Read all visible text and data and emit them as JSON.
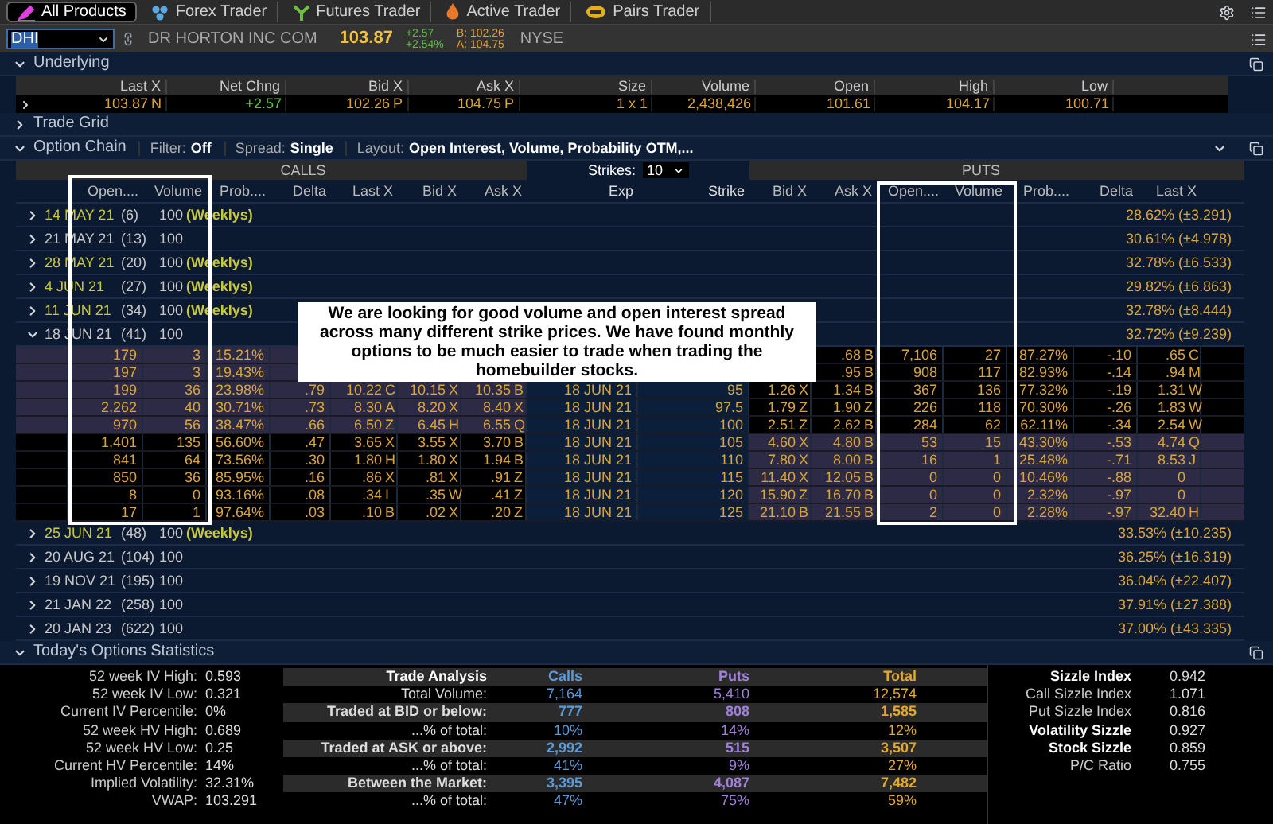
{
  "tabs": [
    {
      "label": "All Products",
      "selected": true,
      "kind": "all"
    },
    {
      "label": "Forex Trader",
      "selected": false,
      "kind": "forex"
    },
    {
      "label": "Futures Trader",
      "selected": false,
      "kind": "futures"
    },
    {
      "label": "Active Trader",
      "selected": false,
      "kind": "active"
    },
    {
      "label": "Pairs Trader",
      "selected": false,
      "kind": "pairs"
    }
  ],
  "symbol": {
    "value": "DHI",
    "company": "DR HORTON INC COM",
    "last": "103.87",
    "change": "+2.57",
    "change_pct": "+2.54%",
    "bid": "B: 102.26",
    "ask": "A: 104.75",
    "exchange": "NYSE"
  },
  "underlying": {
    "title": "Underlying",
    "expanded": true,
    "columns": [
      "Last X",
      "Net Chng",
      "Bid X",
      "Ask X",
      "Size",
      "Volume",
      "Open",
      "High",
      "Low"
    ],
    "values": [
      {
        "text": "103.87",
        "exch": "N",
        "kind": "price"
      },
      {
        "text": "+2.57",
        "kind": "change"
      },
      {
        "text": "102.26",
        "exch": "P",
        "kind": "price"
      },
      {
        "text": "104.75",
        "exch": "P",
        "kind": "price"
      },
      {
        "text": "1 x 1",
        "kind": "price"
      },
      {
        "text": "2,438,426",
        "kind": "price"
      },
      {
        "text": "101.61",
        "kind": "price"
      },
      {
        "text": "104.17",
        "kind": "price"
      },
      {
        "text": "100.71",
        "kind": "price"
      }
    ]
  },
  "trade_grid": {
    "title": "Trade Grid",
    "expanded": false
  },
  "option_chain": {
    "title": "Option Chain",
    "expanded": true,
    "filter_label": "Filter:",
    "filter": "Off",
    "spread_label": "Spread:",
    "spread": "Single",
    "layout_label": "Layout:",
    "layout": "Open Interest, Volume, Probability OTM,...",
    "calls_label": "CALLS",
    "puts_label": "PUTS",
    "strikes_label": "Strikes:",
    "strikes": "10",
    "columns": [
      "Open....",
      "Volume",
      "Prob....",
      "Delta",
      "Last X",
      "Bid X",
      "Ask X",
      "Exp",
      "Strike",
      "Bid X",
      "Ask X",
      "Open....",
      "Volume",
      "Prob....",
      "Delta",
      "Last X"
    ],
    "expirations": [
      {
        "date": "14 MAY 21",
        "days": "(6)",
        "multiplier": "100",
        "weeklys": "(Weeklys)",
        "weekly": true,
        "expanded": false,
        "iv": "28.62% (±3.291)"
      },
      {
        "date": "21 MAY 21",
        "days": "(13)",
        "multiplier": "100",
        "weekly": false,
        "expanded": false,
        "iv": "30.61% (±4.978)"
      },
      {
        "date": "28 MAY 21",
        "days": "(20)",
        "multiplier": "100",
        "weeklys": "(Weeklys)",
        "weekly": true,
        "expanded": false,
        "iv": "32.78% (±6.533)"
      },
      {
        "date": "4 JUN 21",
        "days": "(27)",
        "multiplier": "100",
        "weeklys": "(Weeklys)",
        "weekly": true,
        "expanded": false,
        "iv": "29.82% (±6.863)"
      },
      {
        "date": "11 JUN 21",
        "days": "(34)",
        "multiplier": "100",
        "weeklys": "(Weeklys)",
        "weekly": true,
        "expanded": false,
        "iv": "32.78% (±8.444)"
      },
      {
        "date": "18 JUN 21",
        "days": "(41)",
        "multiplier": "100",
        "weekly": false,
        "expanded": true,
        "iv": "32.72% (±9.239)",
        "rows": [
          {
            "call_itm": true,
            "put_itm": false,
            "call": {
              "open": "179",
              "volume": "3",
              "prob": "15.21%"
            },
            "put": {
              "ask": ".68",
              "ask_x": "B",
              "open": "7,106",
              "volume": "27",
              "prob": "87.27%",
              "delta": "-.10",
              "last": ".65",
              "last_x": "C"
            }
          },
          {
            "call_itm": true,
            "put_itm": false,
            "call": {
              "open": "197",
              "volume": "3",
              "prob": "19.43%"
            },
            "put": {
              "ask": ".95",
              "ask_x": "B",
              "open": "908",
              "volume": "117",
              "prob": "82.93%",
              "delta": "-.14",
              "last": ".94",
              "last_x": "M"
            }
          },
          {
            "call_itm": true,
            "put_itm": false,
            "exp": "18 JUN 21",
            "strike": "95",
            "call": {
              "open": "199",
              "volume": "36",
              "prob": "23.98%",
              "delta": ".79",
              "last": "10.22",
              "last_x": "C",
              "bid": "10.15",
              "bid_x": "X",
              "ask": "10.35",
              "ask_x": "B"
            },
            "put": {
              "bid": "1.26",
              "bid_x": "X",
              "ask": "1.34",
              "ask_x": "B",
              "open": "367",
              "volume": "136",
              "prob": "77.32%",
              "delta": "-.19",
              "last": "1.31",
              "last_x": "W"
            }
          },
          {
            "call_itm": true,
            "put_itm": false,
            "exp": "18 JUN 21",
            "strike": "97.5",
            "call": {
              "open": "2,262",
              "volume": "40",
              "prob": "30.71%",
              "delta": ".73",
              "last": "8.30",
              "last_x": "A",
              "bid": "8.20",
              "bid_x": "X",
              "ask": "8.40",
              "ask_x": "X"
            },
            "put": {
              "bid": "1.79",
              "bid_x": "Z",
              "ask": "1.90",
              "ask_x": "Z",
              "open": "226",
              "volume": "118",
              "prob": "70.30%",
              "delta": "-.26",
              "last": "1.83",
              "last_x": "W"
            }
          },
          {
            "call_itm": true,
            "put_itm": false,
            "exp": "18 JUN 21",
            "strike": "100",
            "call": {
              "open": "970",
              "volume": "56",
              "prob": "38.47%",
              "delta": ".66",
              "last": "6.50",
              "last_x": "Z",
              "bid": "6.45",
              "bid_x": "H",
              "ask": "6.55",
              "ask_x": "Q"
            },
            "put": {
              "bid": "2.51",
              "bid_x": "Z",
              "ask": "2.62",
              "ask_x": "B",
              "open": "284",
              "volume": "62",
              "prob": "62.11%",
              "delta": "-.34",
              "last": "2.54",
              "last_x": "W"
            }
          },
          {
            "call_itm": false,
            "put_itm": true,
            "exp": "18 JUN 21",
            "strike": "105",
            "call": {
              "open": "1,401",
              "volume": "135",
              "prob": "56.60%",
              "delta": ".47",
              "last": "3.65",
              "last_x": "X",
              "bid": "3.55",
              "bid_x": "X",
              "ask": "3.70",
              "ask_x": "B"
            },
            "put": {
              "bid": "4.60",
              "bid_x": "X",
              "ask": "4.80",
              "ask_x": "B",
              "open": "53",
              "volume": "15",
              "prob": "43.30%",
              "delta": "-.53",
              "last": "4.74",
              "last_x": "Q"
            }
          },
          {
            "call_itm": false,
            "put_itm": true,
            "exp": "18 JUN 21",
            "strike": "110",
            "call": {
              "open": "841",
              "volume": "64",
              "prob": "73.56%",
              "delta": ".30",
              "last": "1.80",
              "last_x": "H",
              "bid": "1.80",
              "bid_x": "X",
              "ask": "1.94",
              "ask_x": "B"
            },
            "put": {
              "bid": "7.80",
              "bid_x": "X",
              "ask": "8.00",
              "ask_x": "B",
              "open": "16",
              "volume": "1",
              "prob": "25.48%",
              "delta": "-.71",
              "last": "8.53",
              "last_x": "J"
            }
          },
          {
            "call_itm": false,
            "put_itm": true,
            "exp": "18 JUN 21",
            "strike": "115",
            "call": {
              "open": "850",
              "volume": "36",
              "prob": "85.95%",
              "delta": ".16",
              "last": ".86",
              "last_x": "X",
              "bid": ".81",
              "bid_x": "X",
              "ask": ".91",
              "ask_x": "Z"
            },
            "put": {
              "bid": "11.40",
              "bid_x": "X",
              "ask": "12.05",
              "ask_x": "B",
              "open": "0",
              "volume": "0",
              "prob": "10.46%",
              "delta": "-.88",
              "last": "0"
            }
          },
          {
            "call_itm": false,
            "put_itm": true,
            "exp": "18 JUN 21",
            "strike": "120",
            "call": {
              "open": "8",
              "volume": "0",
              "prob": "93.16%",
              "delta": ".08",
              "last": ".34",
              "last_x": "I",
              "bid": ".35",
              "bid_x": "W",
              "ask": ".41",
              "ask_x": "Z"
            },
            "put": {
              "bid": "15.90",
              "bid_x": "Z",
              "ask": "16.70",
              "ask_x": "B",
              "open": "0",
              "volume": "0",
              "prob": "2.32%",
              "delta": "-.97",
              "last": "0"
            }
          },
          {
            "call_itm": false,
            "put_itm": true,
            "exp": "18 JUN 21",
            "strike": "125",
            "call": {
              "open": "17",
              "volume": "1",
              "prob": "97.64%",
              "delta": ".03",
              "last": ".10",
              "last_x": "B",
              "bid": ".02",
              "bid_x": "X",
              "ask": ".20",
              "ask_x": "Z"
            },
            "put": {
              "bid": "21.10",
              "bid_x": "B",
              "ask": "21.55",
              "ask_x": "B",
              "open": "2",
              "volume": "0",
              "prob": "2.28%",
              "delta": "-.97",
              "last": "32.40",
              "last_x": "H"
            }
          }
        ]
      },
      {
        "date": "25 JUN 21",
        "days": "(48)",
        "multiplier": "100",
        "weeklys": "(Weeklys)",
        "weekly": true,
        "expanded": false,
        "iv": "33.53% (±10.235)"
      },
      {
        "date": "20 AUG 21",
        "days": "(104)",
        "multiplier": "100",
        "weekly": false,
        "expanded": false,
        "iv": "36.25% (±16.319)"
      },
      {
        "date": "19 NOV 21",
        "days": "(195)",
        "multiplier": "100",
        "weekly": false,
        "expanded": false,
        "iv": "36.04% (±22.407)"
      },
      {
        "date": "21 JAN 22",
        "days": "(258)",
        "multiplier": "100",
        "weekly": false,
        "expanded": false,
        "iv": "37.91% (±27.388)"
      },
      {
        "date": "20 JAN 23",
        "days": "(622)",
        "multiplier": "100",
        "weekly": false,
        "expanded": false,
        "iv": "37.00% (±43.335)"
      }
    ],
    "callout": "We are looking for good volume and open interest spread across many different strike prices. We have found monthly options to be much easier to trade when trading the homebuilder stocks."
  },
  "statistics": {
    "title": "Today's Options Statistics",
    "expanded": true,
    "summary": [
      {
        "label": "52 week IV High:",
        "value": "0.593"
      },
      {
        "label": "52 week IV Low:",
        "value": "0.321"
      },
      {
        "label": "Current IV Percentile:",
        "value": "0%"
      },
      {
        "label": "52 week HV High:",
        "value": "0.689"
      },
      {
        "label": "52 week HV Low:",
        "value": "0.25"
      },
      {
        "label": "Current HV Percentile:",
        "value": "14%"
      },
      {
        "label": "Implied Volatility:",
        "value": "32.31%"
      },
      {
        "label": "VWAP:",
        "value": "103.291"
      }
    ],
    "analysis_columns": [
      "Trade Analysis",
      "Calls",
      "Puts",
      "Total"
    ],
    "analysis": [
      {
        "label": "Total Volume:",
        "calls": "7,164",
        "puts": "5,410",
        "total": "12,574",
        "bold": false
      },
      {
        "label": "Traded at BID or below:",
        "calls": "777",
        "puts": "808",
        "total": "1,585",
        "bold": true
      },
      {
        "label": "...% of total:",
        "calls": "10%",
        "puts": "14%",
        "total": "12%",
        "bold": false
      },
      {
        "label": "Traded at ASK or above:",
        "calls": "2,992",
        "puts": "515",
        "total": "3,507",
        "bold": true
      },
      {
        "label": "...% of total:",
        "calls": "41%",
        "puts": "9%",
        "total": "27%",
        "bold": false
      },
      {
        "label": "Between the Market:",
        "calls": "3,395",
        "puts": "4,087",
        "total": "7,482",
        "bold": true
      },
      {
        "label": "...% of total:",
        "calls": "47%",
        "puts": "75%",
        "total": "59%",
        "bold": false
      }
    ],
    "sizzle": [
      {
        "label": "Sizzle Index",
        "value": "0.942",
        "bold": true
      },
      {
        "label": "Call Sizzle Index",
        "value": "1.071",
        "bold": false
      },
      {
        "label": "Put Sizzle Index",
        "value": "0.816",
        "bold": false
      },
      {
        "label": "Volatility Sizzle",
        "value": "0.927",
        "bold": true
      },
      {
        "label": "Stock Sizzle",
        "value": "0.859",
        "bold": true
      },
      {
        "label": "P/C Ratio",
        "value": "0.755",
        "bold": false
      }
    ]
  }
}
